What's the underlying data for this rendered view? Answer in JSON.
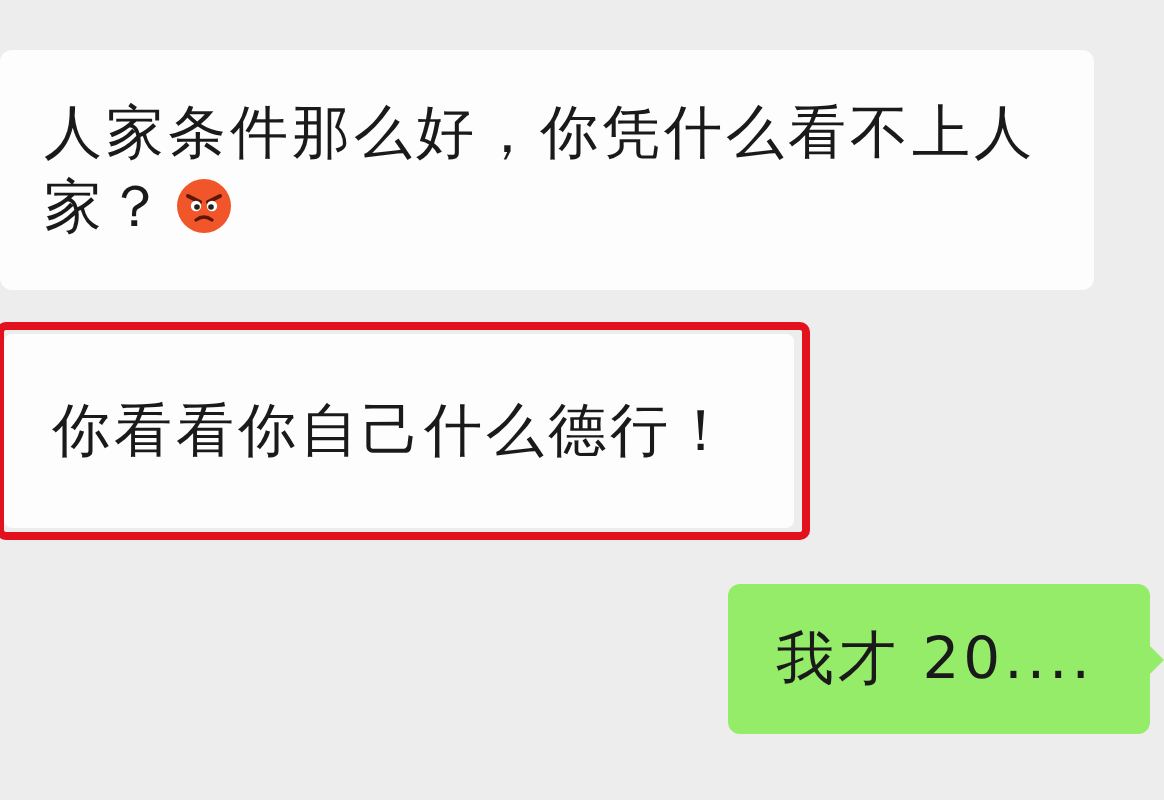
{
  "messages": [
    {
      "kind": "received",
      "text": "人家条件那么好，你凭什么看不上人家？",
      "has_emoji": true
    },
    {
      "kind": "received",
      "text": "你看看你自己什么德行！",
      "highlighted": true
    },
    {
      "kind": "sent",
      "text": "我才 20...."
    }
  ]
}
